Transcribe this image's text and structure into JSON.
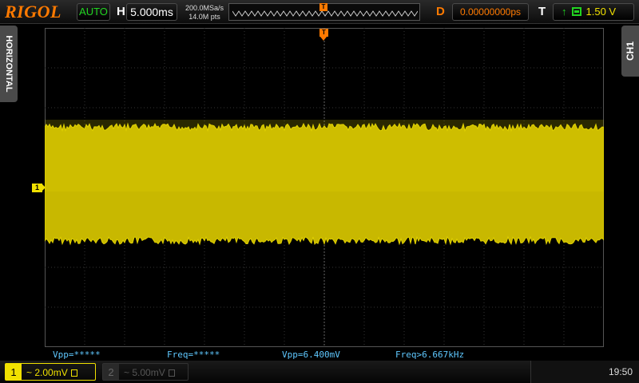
{
  "brand": "RIGOL",
  "top": {
    "run_status": "AUTO",
    "h_label": "H",
    "timebase": "5.000ms",
    "sample_rate": "200.0MSa/s",
    "memory_depth": "14.0M pts",
    "trigger_pos_marker": "T",
    "d_label": "D",
    "delay": "0.00000000ps",
    "t_label": "T",
    "trigger_level": "1.50 V"
  },
  "side": {
    "horizontal_tab": "HORIZONTAL",
    "ch1_tab": "CH1"
  },
  "screen": {
    "ch1_marker": "1",
    "trigger_marker": "T"
  },
  "measurements": [
    "Vpp=*****",
    "Freq=*****",
    "Vpp=6.400mV",
    "Freq>6.667kHz"
  ],
  "bottom": {
    "ch1_number": "1",
    "ch1_scale": "~ 2.00mV",
    "ch2_number": "2",
    "ch2_scale": "~ 5.00mV",
    "clock": "19:50"
  },
  "colors": {
    "ch1": "#f0e000",
    "trigger": "#ff7a00",
    "measurement": "#5fc8ff",
    "run_status": "#21d421"
  }
}
